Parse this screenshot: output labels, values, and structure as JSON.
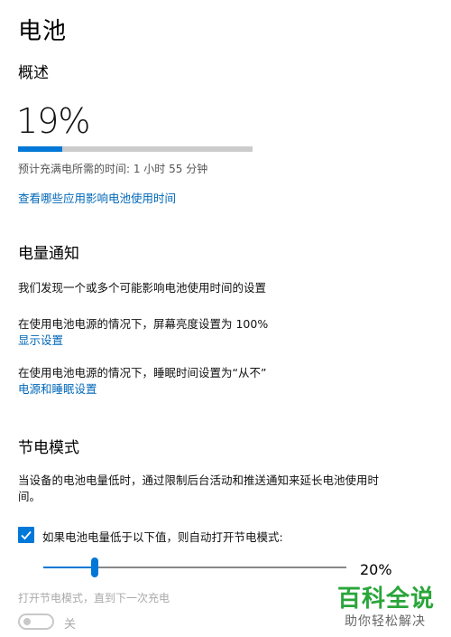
{
  "page": {
    "title": "电池"
  },
  "overview": {
    "heading": "概述",
    "percentage": "19%",
    "charge_fraction": 0.19,
    "time_to_full": "预计充满电所需的时间: 1 小时 55 分钟",
    "apps_link": "查看哪些应用影响电池使用时间"
  },
  "notifications": {
    "heading": "电量通知",
    "summary": "我们发现一个或多个可能影响电池使用时间的设置",
    "brightness_text": "在使用电池电源的情况下，屏幕亮度设置为 100%",
    "display_link": "显示设置",
    "sleep_text": "在使用电池电源的情况下，睡眠时间设置为“从不”",
    "power_link": "电源和睡眠设置"
  },
  "saver": {
    "heading": "节电模式",
    "description_line1": "当设备的电池电量低时，通过限制后台活动和推送通知来延长电池使用时",
    "description_line2": "间。",
    "auto_checkbox_label": "如果电池电量低于以下值，则自动打开节电模式:",
    "auto_checkbox_checked": true,
    "threshold_fraction": 0.2,
    "threshold_value": "20%",
    "toggle_label": "打开节电模式，直到下一次充电",
    "toggle_state": "关",
    "toggle_on": false
  },
  "watermark": {
    "title": "百科全说",
    "subtitle": "助你轻松解决"
  },
  "colors": {
    "accent": "#0078d7",
    "link": "#0067b8",
    "watermark_green": "#2aa53a"
  }
}
